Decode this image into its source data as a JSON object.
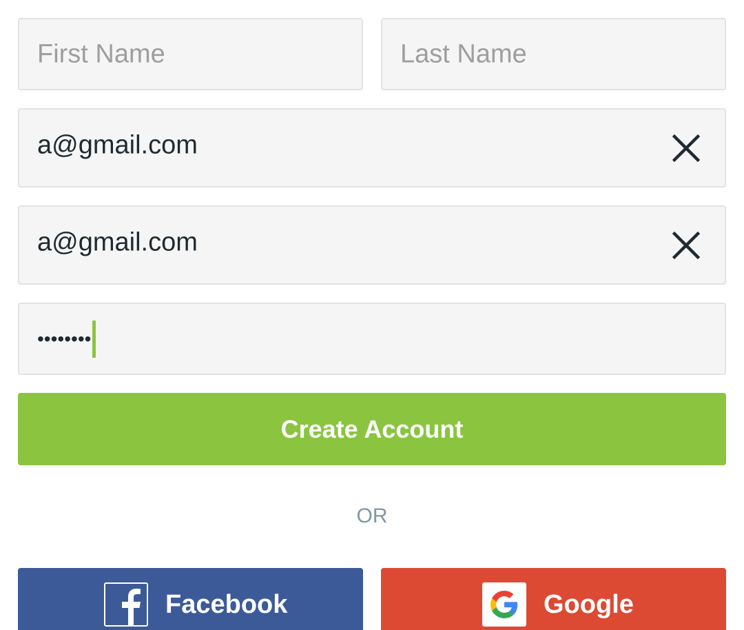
{
  "form": {
    "first_name": {
      "placeholder": "First Name",
      "value": ""
    },
    "last_name": {
      "placeholder": "Last Name",
      "value": ""
    },
    "email": {
      "value": "a@gmail.com"
    },
    "confirm_email": {
      "value": "a@gmail.com"
    },
    "password": {
      "masked_value": "••••••••"
    },
    "submit_label": "Create Account"
  },
  "divider_text": "OR",
  "social": {
    "facebook": {
      "label": "Facebook",
      "icon": "facebook-icon",
      "color": "#3d5a98"
    },
    "google": {
      "label": "Google",
      "icon": "google-icon",
      "color": "#dc4a33"
    }
  },
  "colors": {
    "accent": "#8bc540",
    "field_bg": "#f5f5f5",
    "field_border": "#e2e2e2",
    "muted_text": "#7d97a6"
  }
}
